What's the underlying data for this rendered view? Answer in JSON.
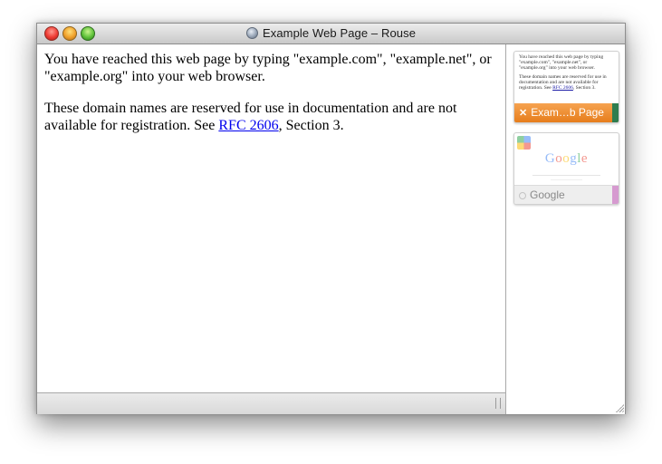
{
  "window": {
    "title": "Example Web Page – Rouse",
    "traffic_lights": {
      "close": "#ee3b33",
      "minimize": "#f0a02a",
      "zoom": "#5fc13a"
    },
    "title_icon": "globe-icon"
  },
  "content": {
    "paragraph1": "You have reached this web page by typing \"example.com\", \"example.net\", or \"example.org\" into your web browser.",
    "paragraph2_prefix": "These domain names are reserved for use in documentation and are not available for registration. See ",
    "paragraph2_link": "RFC 2606",
    "paragraph2_suffix": ", Section 3."
  },
  "sidebar": {
    "thumbnails": [
      {
        "label": "Exam…b Page",
        "close_icon": "close-icon",
        "preview_text1": "You have reached this web page by typing \"example.com\", \"example.net\", or \"example.org\" into your web browser.",
        "preview_text2_prefix": "These domain names are reserved for use in documentation and are not available for registration. See ",
        "preview_link": "RFC 2606",
        "preview_text2_suffix": ", Section 3.",
        "accent": "#e67d1c",
        "active": true
      },
      {
        "label": "Google",
        "preview_logo": "Google",
        "accent": "#d69ad0",
        "active": false
      }
    ]
  }
}
